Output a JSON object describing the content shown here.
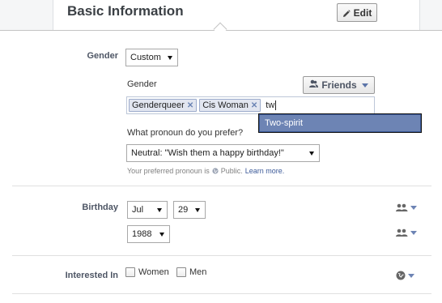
{
  "header": {
    "title": "Basic Information",
    "edit_label": "Edit"
  },
  "gender": {
    "label": "Gender",
    "select_value": "Custom",
    "custom_label": "Gender",
    "audience_label": "Friends",
    "tokens": [
      "Genderqueer",
      "Cis Woman"
    ],
    "typed_text": "tw",
    "suggestion": "Two-spirit",
    "pronoun_question": "What pronoun do you prefer?",
    "pronoun_value": "Neutral: \"Wish them a happy birthday!\"",
    "privacy_prefix": "Your preferred pronoun is",
    "privacy_value": "Public.",
    "learn_more": "Learn more."
  },
  "birthday": {
    "label": "Birthday",
    "month": "Jul",
    "day": "29",
    "year": "1988"
  },
  "interested_in": {
    "label": "Interested In",
    "options": [
      "Women",
      "Men"
    ]
  },
  "colors": {
    "accent": "#3b5998",
    "suggestion_bg": "#6d84b4",
    "label_text": "#4e5665"
  },
  "icons": {
    "edit": "pencil-icon",
    "friends": "friends-icon",
    "audience": "friends-icon",
    "interested_audience": "globe-icon",
    "token_remove": "close-icon"
  }
}
